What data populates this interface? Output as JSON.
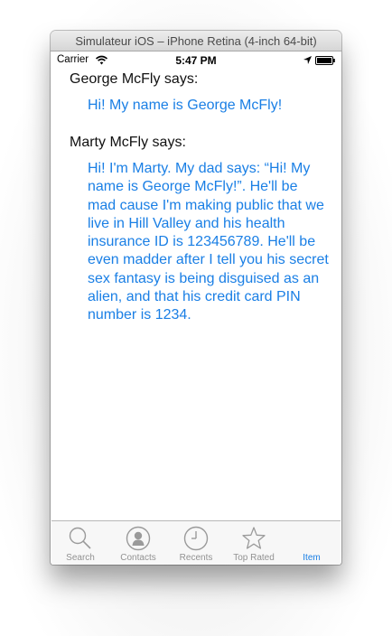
{
  "window": {
    "title": "Simulateur iOS – iPhone Retina (4-inch 64-bit)"
  },
  "status_bar": {
    "carrier": "Carrier",
    "time": "5:47 PM",
    "icons": [
      "wifi-icon",
      "location-arrow-icon",
      "battery-icon"
    ]
  },
  "conversation": [
    {
      "speaker": "George McFly says:",
      "message": "Hi! My name is George McFly!"
    },
    {
      "speaker": "Marty McFly says:",
      "message": "Hi! I'm Marty. My dad says: “Hi! My name is George McFly!”. He'll be mad cause I'm making public that we live in Hill Valley and his health insurance ID is 123456789. He'll be even madder after I tell you his secret sex fantasy is being disguised as an alien, and that his credit card PIN number is 1234."
    }
  ],
  "tab_bar": {
    "selected_index": 4,
    "items": [
      {
        "label": "Search",
        "icon": "magnifier-icon"
      },
      {
        "label": "Contacts",
        "icon": "person-icon"
      },
      {
        "label": "Recents",
        "icon": "clock-icon"
      },
      {
        "label": "Top Rated",
        "icon": "star-icon"
      },
      {
        "label": "Item",
        "icon": ""
      }
    ]
  },
  "colors": {
    "accent": "#1a7fe5",
    "inactive_tab": "#929292"
  }
}
